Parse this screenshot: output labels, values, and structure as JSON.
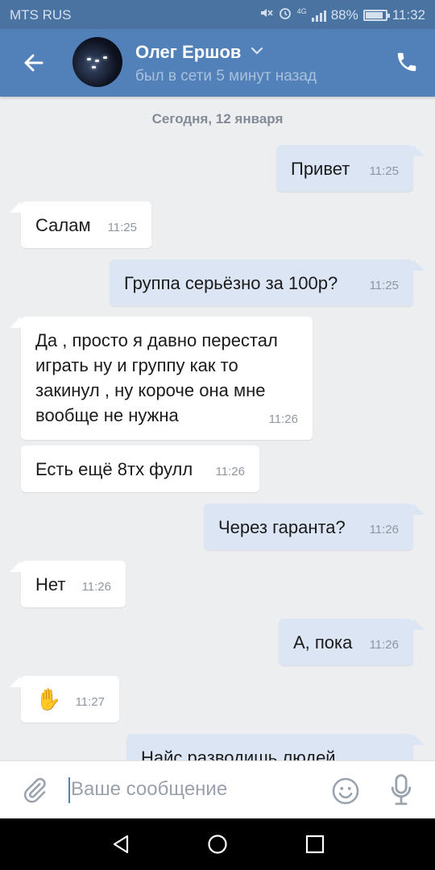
{
  "status_bar": {
    "carrier": "MTS RUS",
    "network": "4G",
    "battery_percent": "88%",
    "battery_level": 0.88,
    "time": "11:32",
    "icons": [
      "mute-icon",
      "alarm-icon",
      "signal-icon",
      "battery-icon"
    ]
  },
  "header": {
    "contact_name": "Олег Ершов",
    "last_seen": "был в сети 5 минут назад",
    "icons": [
      "back-arrow-icon",
      "chevron-down-icon",
      "phone-icon"
    ]
  },
  "chat": {
    "date_separator": "Сегодня, 12 января",
    "messages": [
      {
        "direction": "out",
        "text": "Привет",
        "time": "11:25"
      },
      {
        "direction": "in",
        "text": "Салам",
        "time": "11:25"
      },
      {
        "direction": "out",
        "text": "Группа серьёзно за 100р?",
        "time": "11:25"
      },
      {
        "direction": "in",
        "text": "Да , просто я давно перестал играть ну и группу как то закинул , ну короче она мне вообще не нужна",
        "time": "11:26"
      },
      {
        "direction": "in",
        "text": "Есть ещё 8тх фулл",
        "time": "11:26"
      },
      {
        "direction": "out",
        "text": "Через гаранта?",
        "time": "11:26"
      },
      {
        "direction": "in",
        "text": "Нет",
        "time": "11:26"
      },
      {
        "direction": "out",
        "text": "А, пока",
        "time": "11:26"
      },
      {
        "direction": "in",
        "text": "✋",
        "time": "11:27"
      },
      {
        "direction": "out",
        "text": "Найс разводишь людей",
        "time": ""
      }
    ]
  },
  "composer": {
    "placeholder": "Ваше сообщение",
    "icons": [
      "paperclip-icon",
      "smiley-icon",
      "microphone-icon"
    ]
  },
  "nav_bar": {
    "icons": [
      "nav-back-icon",
      "nav-home-icon",
      "nav-recents-icon"
    ]
  },
  "colors": {
    "header_bg": "#5181b8",
    "incoming_bubble": "#ffffff",
    "outgoing_bubble": "#dbe5f4",
    "chat_bg": "#edeef0"
  }
}
